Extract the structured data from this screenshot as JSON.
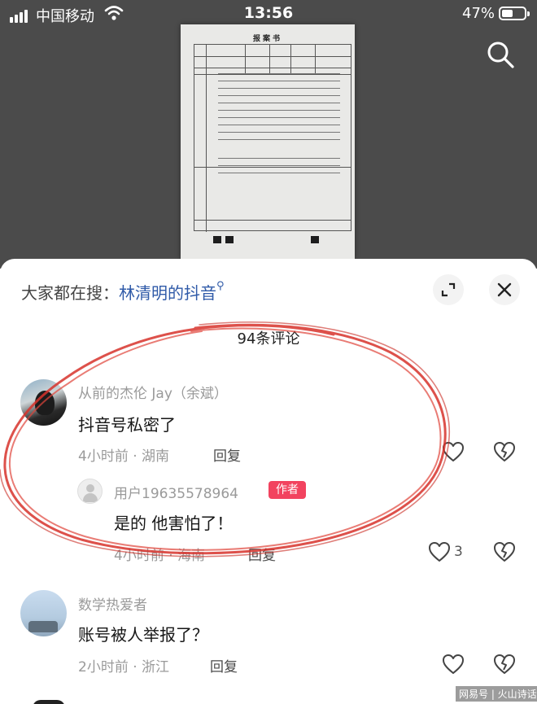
{
  "status_bar": {
    "carrier": "中国移动",
    "time": "13:56",
    "battery": "47%"
  },
  "document": {
    "title": "报案书",
    "icon": "document-photo"
  },
  "panel": {
    "hot_search_label": "大家都在搜：",
    "hot_search_keyword": "林清明的抖音",
    "comment_count": "94条评论"
  },
  "comments": [
    {
      "user": "从前的杰伦 Jay（余斌）",
      "text": "抖音号私密了",
      "meta": "4小时前 · 湖南",
      "reply_label": "回复",
      "reply": {
        "user": "用户19635578964",
        "badge": "作者",
        "text": "是的 他害怕了！",
        "meta": "4小时前 · 海南",
        "reply_label": "回复",
        "likes": "3"
      }
    },
    {
      "user": "数学热爱者",
      "text": "账号被人举报了？",
      "meta": "2小时前 · 浙江",
      "reply_label": "回复"
    }
  ],
  "watermark": "网易号 | 火山诗话",
  "colors": {
    "accent_link": "#2f5aa8",
    "author_badge": "#f2435f",
    "annotation": "#d7332b"
  },
  "icons": [
    "signal-icon",
    "wifi-icon",
    "battery-icon",
    "search-icon",
    "expand-icon",
    "close-icon",
    "search-keyword-icon",
    "heart-icon",
    "dislike-icon",
    "default-avatar-icon"
  ]
}
